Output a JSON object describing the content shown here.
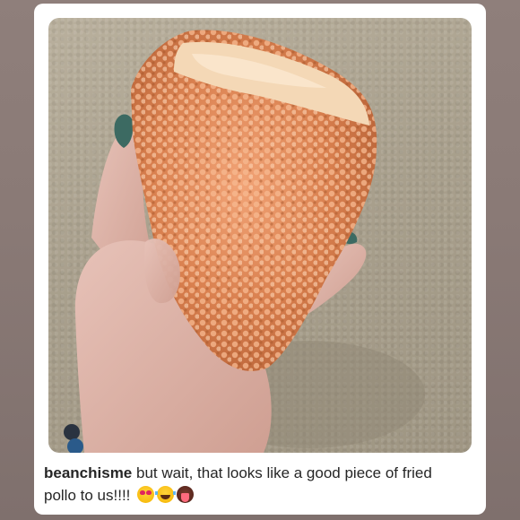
{
  "post": {
    "photo_alt": "hand holding an orange crystal cluster that looks like fried chicken",
    "caption": {
      "username": "beanchisme",
      "text": " but wait, that looks like a good piece of fried pollo to us!!!! ",
      "emojis": [
        "heart-eyes-emoji",
        "tears-of-joy-emoji",
        "tongue-emoji"
      ]
    }
  }
}
